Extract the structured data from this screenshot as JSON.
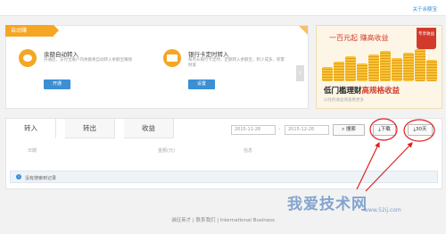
{
  "top": {
    "link": "关于余额宝"
  },
  "auto": {
    "tag": "自动赚",
    "features": [
      {
        "title": "余额自动转入",
        "desc": "开通后，支付宝账户内余额将自动转入余额宝赚钱",
        "button": "开通"
      },
      {
        "title": "银行卡定时转入",
        "desc": "每月从银行卡定时、定额转入余额宝，积少成多，积累财富",
        "button": "设置"
      }
    ],
    "next": "›"
  },
  "ad": {
    "headline": "一百元起 赚高收益",
    "tag": "专享收益",
    "title": "低门槛理财",
    "title_highlight": "高规格收益",
    "sub": "以往的收益请查看更多"
  },
  "panel": {
    "tabs": [
      "转入",
      "转出",
      "收益"
    ],
    "date_from": "2015-11-28",
    "date_sep": "-",
    "date_to": "2015-12-28",
    "search": "搜索",
    "download": "下载",
    "days30": "30天",
    "columns": [
      "日期",
      "金额(元)",
      "信息"
    ],
    "empty": "没有搜索到记录"
  },
  "footer": "诚征英才 | 联系我们 | International Business",
  "watermark": {
    "text": "我爱技术网",
    "url": "www.52ij.com"
  }
}
